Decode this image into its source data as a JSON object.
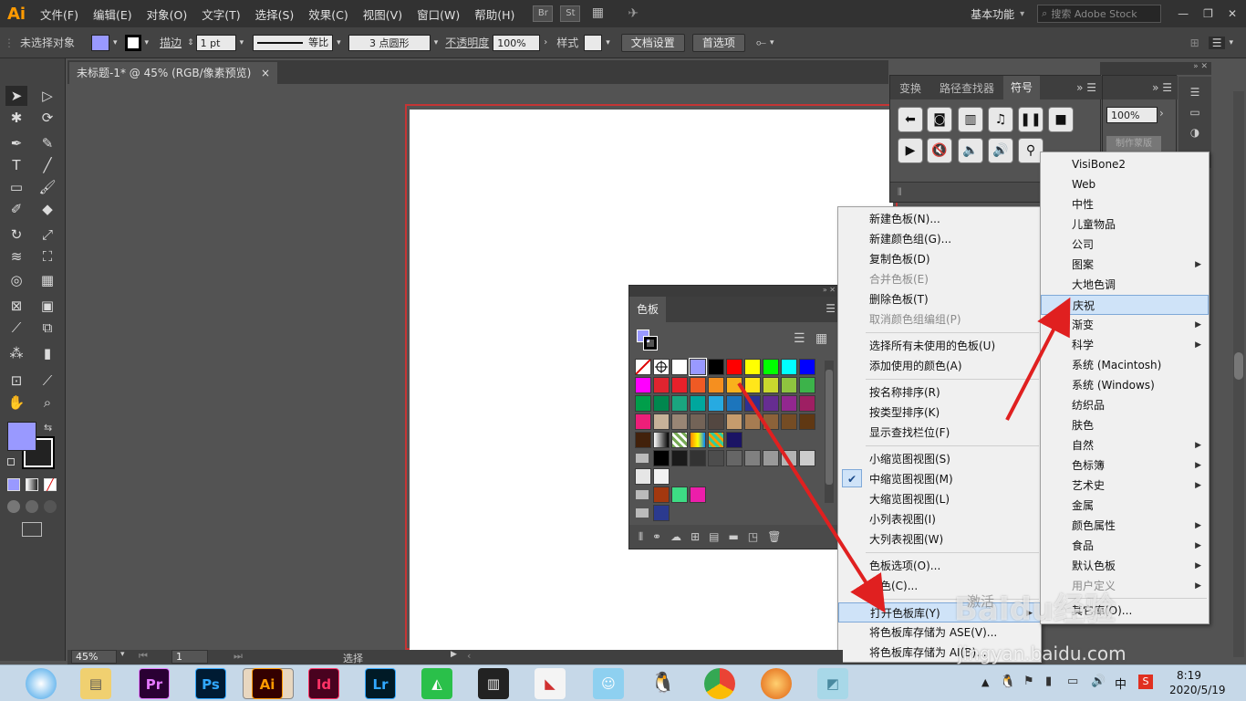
{
  "app": {
    "logo": "Ai",
    "workspace": "基本功能",
    "search_placeholder": "搜索 Adobe Stock"
  },
  "menubar": {
    "items": [
      "文件(F)",
      "编辑(E)",
      "对象(O)",
      "文字(T)",
      "选择(S)",
      "效果(C)",
      "视图(V)",
      "窗口(W)",
      "帮助(H)"
    ],
    "br": "Br",
    "st": "St"
  },
  "control": {
    "no_selection": "未选择对象",
    "stroke_label": "描边",
    "stroke_value": "1 pt",
    "profile": "等比",
    "brush": "3 点圆形",
    "opacity_label": "不透明度",
    "opacity_value": "100%",
    "style_label": "样式",
    "doc_settings": "文档设置",
    "preferences": "首选项"
  },
  "document": {
    "tab_title": "未标题-1* @ 45% (RGB/像素预览)",
    "close": "×"
  },
  "status": {
    "zoom": "45%",
    "page": "1",
    "tool": "选择"
  },
  "swatches_panel": {
    "title": "色板"
  },
  "symbols_panel": {
    "tabs": [
      "变换",
      "路径查找器",
      "符号"
    ],
    "zoom": "100%",
    "side_label": "制作蒙版"
  },
  "context_menu": {
    "items": [
      {
        "label": "新建色板(N)...",
        "disabled": false
      },
      {
        "label": "新建颜色组(G)...",
        "disabled": false
      },
      {
        "label": "复制色板(D)",
        "disabled": false
      },
      {
        "label": "合并色板(E)",
        "disabled": true
      },
      {
        "label": "删除色板(T)",
        "disabled": false
      },
      {
        "label": "取消颜色组编组(P)",
        "disabled": true
      },
      {
        "label": "选择所有未使用的色板(U)",
        "disabled": false
      },
      {
        "label": "添加使用的颜色(A)",
        "disabled": false
      },
      {
        "label": "按名称排序(R)",
        "disabled": false
      },
      {
        "label": "按类型排序(K)",
        "disabled": false
      },
      {
        "label": "显示查找栏位(F)",
        "disabled": false
      },
      {
        "label": "小缩览图视图(S)",
        "disabled": false
      },
      {
        "label": "中缩览图视图(M)",
        "disabled": false
      },
      {
        "label": "大缩览图视图(L)",
        "disabled": false
      },
      {
        "label": "小列表视图(I)",
        "disabled": false
      },
      {
        "label": "大列表视图(W)",
        "disabled": false
      },
      {
        "label": "色板选项(O)...",
        "disabled": false
      },
      {
        "label": "专色(C)...",
        "disabled": false
      },
      {
        "label": "打开色板库(Y)",
        "disabled": false
      },
      {
        "label": "将色板库存储为 ASE(V)...",
        "disabled": false
      },
      {
        "label": "将色板库存储为 AI(B)...",
        "disabled": false
      }
    ]
  },
  "submenu": {
    "items": [
      "VisiBone2",
      "Web",
      "中性",
      "儿童物品",
      "公司",
      "图案",
      "大地色调",
      "庆祝",
      "渐变",
      "科学",
      "系统 (Macintosh)",
      "系统 (Windows)",
      "纺织品",
      "肤色",
      "自然",
      "色标簿",
      "艺术史",
      "金属",
      "颜色属性",
      "食品",
      "默认色板",
      "用户定义",
      "其它库(O)..."
    ]
  },
  "taskbar": {
    "apps": [
      "Pr",
      "Ps",
      "Ai",
      "Id",
      "Lr"
    ],
    "time": "8:19",
    "date": "2020/5/19",
    "ime": "中"
  },
  "watermark": {
    "brand": "Baidu经验",
    "url": "jingyan.baidu.com",
    "activate": "激活"
  },
  "colors": {
    "accent": "#ff9a00",
    "arrow": "#e02020",
    "selection": "#cfe3f8",
    "fill": "#9999ff"
  }
}
